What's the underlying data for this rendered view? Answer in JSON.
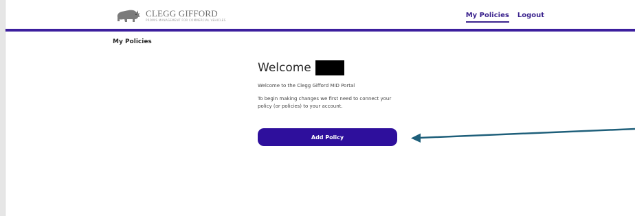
{
  "header": {
    "logo": {
      "name": "CLEGG GIFFORD",
      "tagline": "PROMIS MANAGEMENT FOR COMMERCIAL VEHICLES",
      "icon": "rhino-icon"
    },
    "nav": [
      {
        "label": "My Policies",
        "active": true
      },
      {
        "label": "Logout",
        "active": false
      }
    ]
  },
  "breadcrumb": "My Policies",
  "main": {
    "welcome_label": "Welcome",
    "intro": "Welcome to the Clegg Gifford MID Portal",
    "instruction": "To begin making changes we first need to connect your policy (or policies) to your account.",
    "add_button_label": "Add Policy"
  },
  "colors": {
    "brand": "#3a228d",
    "button": "#2e0f9c",
    "annotation_arrow": "#1e5f7a"
  }
}
